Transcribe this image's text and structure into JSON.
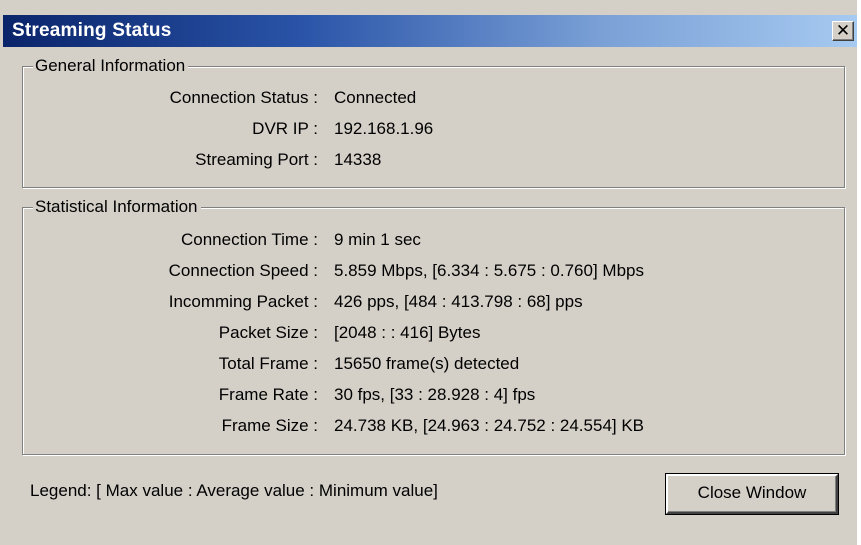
{
  "window": {
    "title": "Streaming Status",
    "close_glyph": "✕"
  },
  "general": {
    "title": "General Information",
    "rows": [
      {
        "label": "Connection Status :",
        "value": "Connected"
      },
      {
        "label": "DVR IP :",
        "value": "192.168.1.96"
      },
      {
        "label": "Streaming Port :",
        "value": "14338"
      }
    ]
  },
  "statistics": {
    "title": "Statistical Information",
    "rows": [
      {
        "label": "Connection Time :",
        "value": "9 min 1 sec"
      },
      {
        "label": "Connection Speed :",
        "value": "5.859 Mbps, [6.334 : 5.675 : 0.760] Mbps"
      },
      {
        "label": "Incomming Packet :",
        "value": "426 pps, [484 : 413.798 : 68] pps"
      },
      {
        "label": "Packet Size :",
        "value": "[2048 : : 416] Bytes"
      },
      {
        "label": "Total Frame :",
        "value": "15650 frame(s) detected"
      },
      {
        "label": "Frame Rate :",
        "value": "30 fps, [33 : 28.928 : 4] fps"
      },
      {
        "label": "Frame Size :",
        "value": "24.738 KB, [24.963 : 24.752 : 24.554] KB"
      }
    ]
  },
  "legend": "Legend: [ Max value : Average value : Minimum value]",
  "close_window_label": "Close Window",
  "icons": {
    "close": "close-icon"
  }
}
